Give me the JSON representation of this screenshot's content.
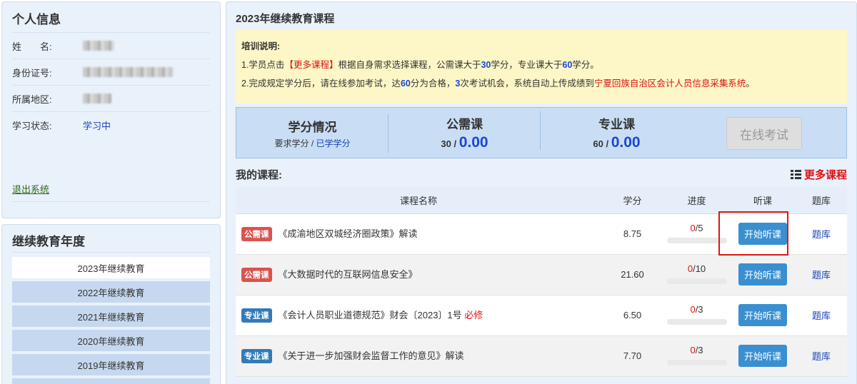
{
  "personal_info": {
    "title": "个人信息",
    "rows": [
      {
        "label": "姓　　名:"
      },
      {
        "label": "身份证号:"
      },
      {
        "label": "所属地区:"
      },
      {
        "label": "学习状态:",
        "value": "学习中"
      }
    ],
    "logout": "退出系统"
  },
  "years": {
    "title": "继续教育年度",
    "items": [
      "2023年继续教育",
      "2022年继续教育",
      "2021年继续教育",
      "2020年继续教育",
      "2019年继续教育"
    ],
    "active_index": 0
  },
  "main": {
    "title": "2023年继续教育课程",
    "notice": {
      "title": "培训说明:",
      "line1": {
        "a": "1.学员点击",
        "b": "【更多课程】",
        "c": "根据自身需求选择课程，公需课大于",
        "d": "30",
        "e": "学分，专业课大于",
        "f": "60",
        "g": "学分。"
      },
      "line2": {
        "a": "2.完成规定学分后，请在线参加考试，达",
        "b": "60",
        "c": "分为合格，",
        "d": "3",
        "e": "次考试机会，系统自动上传成绩到",
        "f": "宁夏回族自治区会计人员信息采集系统",
        "g": "。"
      }
    },
    "credits": {
      "summary_title": "学分情况",
      "summary_sub_a": "要求学分 / ",
      "summary_sub_b": "已学学分",
      "public_title": "公需课",
      "public_required": "30",
      "public_earned": "0.00",
      "pro_title": "专业课",
      "pro_required": "60",
      "pro_earned": "0.00",
      "slash": " / ",
      "exam_button": "在线考试"
    },
    "my_courses_title": "我的课程:",
    "more_courses": "更多课程",
    "table": {
      "headers": [
        "课程名称",
        "学分",
        "进度",
        "听课",
        "题库"
      ],
      "rows": [
        {
          "tag": "公需课",
          "tag_type": "pub",
          "name": "《成渝地区双城经济圈政策》解读",
          "must": "",
          "credit": "8.75",
          "done": "0",
          "total": "/5",
          "progress": 0,
          "action": "开始听课",
          "bank": "题库"
        },
        {
          "tag": "公需课",
          "tag_type": "pub",
          "name": "《大数据时代的互联网信息安全》",
          "must": "",
          "credit": "21.60",
          "done": "0",
          "total": "/10",
          "progress": 0,
          "action": "开始听课",
          "bank": "题库"
        },
        {
          "tag": "专业课",
          "tag_type": "pro",
          "name": "《会计人员职业道德规范》财会〔2023〕1号",
          "must": "必修",
          "credit": "6.50",
          "done": "0",
          "total": "/3",
          "progress": 0,
          "action": "开始听课",
          "bank": "题库"
        },
        {
          "tag": "专业课",
          "tag_type": "pro",
          "name": "《关于进一步加强财会监督工作的意见》解读",
          "must": "",
          "credit": "7.70",
          "done": "0",
          "total": "/3",
          "progress": 0,
          "action": "开始听课",
          "bank": "题库"
        }
      ]
    }
  },
  "colors": {
    "accent_blue": "#1a45d8",
    "alert_red": "#dd1111",
    "public_tag": "#d9534f",
    "pro_tag": "#337ab7",
    "listen_button": "#3a8fd0"
  }
}
